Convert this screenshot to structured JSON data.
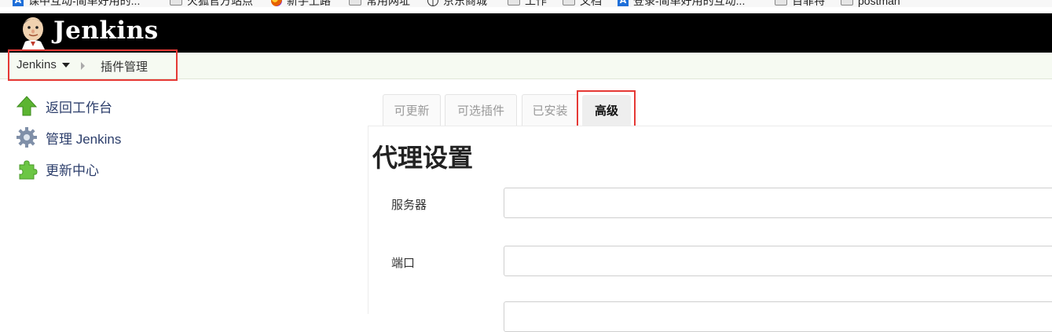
{
  "bookmarks": [
    {
      "label": "课中互动-简单好用的...",
      "icon": "a-icon"
    },
    {
      "label": "火狐官方站点",
      "icon": "folder-icon"
    },
    {
      "label": "新手上路",
      "icon": "firefox-icon"
    },
    {
      "label": "常用网址",
      "icon": "folder-icon"
    },
    {
      "label": "京东商城",
      "icon": "globe-icon"
    },
    {
      "label": "工作",
      "icon": "folder-icon"
    },
    {
      "label": "文档",
      "icon": "folder-icon"
    },
    {
      "label": "登录-简单好用的互动...",
      "icon": "a-icon"
    },
    {
      "label": "百菲特",
      "icon": "folder-icon"
    },
    {
      "label": "postman",
      "icon": "folder-icon"
    }
  ],
  "header": {
    "logo_text": "Jenkins"
  },
  "breadcrumb": {
    "root": "Jenkins",
    "current": "插件管理"
  },
  "sidebar": {
    "items": [
      {
        "label": "返回工作台",
        "icon": "up-arrow-icon"
      },
      {
        "label": "管理 Jenkins",
        "icon": "gear-icon"
      },
      {
        "label": "更新中心",
        "icon": "puzzle-icon"
      }
    ]
  },
  "tabs": [
    {
      "label": "可更新",
      "active": false
    },
    {
      "label": "可选插件",
      "active": false
    },
    {
      "label": "已安装",
      "active": false
    },
    {
      "label": "高级",
      "active": true
    }
  ],
  "proxy": {
    "title": "代理设置",
    "server_label": "服务器",
    "server_value": "",
    "port_label": "端口",
    "port_value": ""
  },
  "colors": {
    "header_bg": "#000000",
    "breadcrumb_bg": "#f6faf2",
    "highlight_border": "#e53935",
    "sidebar_link": "#2c3e6b"
  }
}
